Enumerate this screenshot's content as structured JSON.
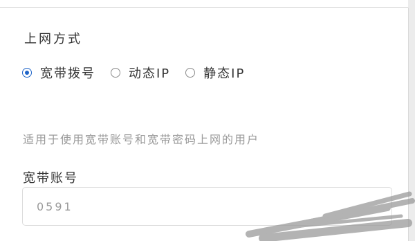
{
  "connection": {
    "title": "上网方式",
    "options": [
      {
        "label": "宽带拨号",
        "checked": true
      },
      {
        "label": "动态IP",
        "checked": false
      },
      {
        "label": "静态IP",
        "checked": false
      }
    ],
    "description": "适用于使用宽带账号和宽带密码上网的用户",
    "account_label": "宽带账号",
    "account_value": "0591"
  },
  "colors": {
    "accent": "#1e64c8",
    "muted_text": "#9a9a9a"
  }
}
